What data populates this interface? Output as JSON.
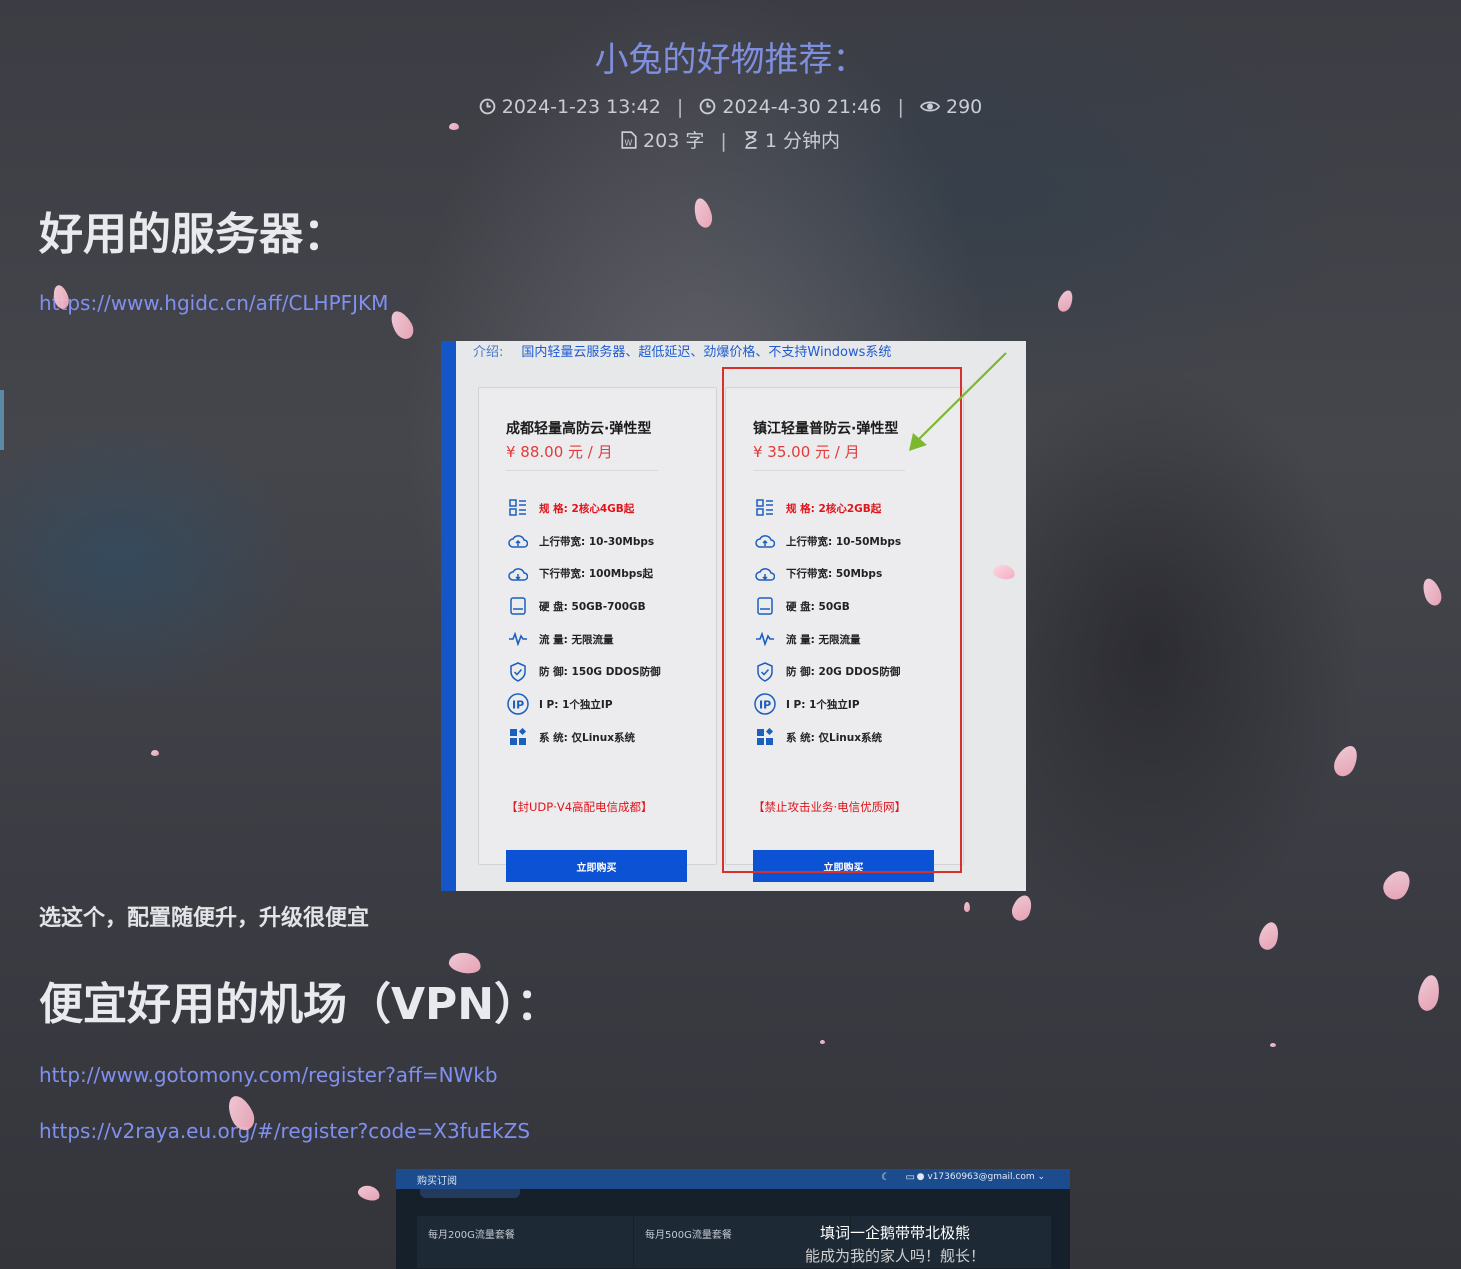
{
  "post": {
    "title": "小兔的好物推荐：",
    "created": "2024-1-23 13:42",
    "updated": "2024-4-30 21:46",
    "views": "290",
    "word_count": "203 字",
    "read_time": "1 分钟内"
  },
  "section1": {
    "heading": "好用的服务器：",
    "link": "https://www.hgidc.cn/aff/CLHPFJKM"
  },
  "server_shot": {
    "intro_key": "介绍:",
    "intro_value": "国内轻量云服务器、超低延迟、劲爆价格、不支持Windows系统",
    "cards": [
      {
        "name": "成都轻量高防云·弹性型",
        "price": "¥ 88.00 元 / 月",
        "specs": [
          {
            "icon": "spec-grid-icon",
            "text": "规 格: 2核心4GB起",
            "red": true
          },
          {
            "icon": "cloud-upload-icon",
            "text": "上行带宽: 10-30Mbps"
          },
          {
            "icon": "cloud-download-icon",
            "text": "下行带宽: 100Mbps起"
          },
          {
            "icon": "disk-icon",
            "text": "硬 盘: 50GB-700GB"
          },
          {
            "icon": "pulse-icon",
            "text": "流 量: 无限流量"
          },
          {
            "icon": "shield-icon",
            "text": "防 御: 150G DDOS防御"
          },
          {
            "icon": "ip-icon",
            "text": "I P: 1个独立IP"
          },
          {
            "icon": "apps-icon",
            "text": "系 统: 仅Linux系统"
          }
        ],
        "note": "【封UDP·V4高配电信成都】",
        "button": "立即购买"
      },
      {
        "name": "镇江轻量普防云·弹性型",
        "price": "¥ 35.00 元 / 月",
        "specs": [
          {
            "icon": "spec-grid-icon",
            "text": "规 格: 2核心2GB起",
            "red": true
          },
          {
            "icon": "cloud-upload-icon",
            "text": "上行带宽: 10-50Mbps"
          },
          {
            "icon": "cloud-download-icon",
            "text": "下行带宽: 50Mbps"
          },
          {
            "icon": "disk-icon",
            "text": "硬 盘: 50GB"
          },
          {
            "icon": "pulse-icon",
            "text": "流 量: 无限流量"
          },
          {
            "icon": "shield-icon",
            "text": "防 御: 20G DDOS防御"
          },
          {
            "icon": "ip-icon",
            "text": "I P: 1个独立IP"
          },
          {
            "icon": "apps-icon",
            "text": "系 统: 仅Linux系统"
          }
        ],
        "note": "【禁止攻击业务·电信优质网】",
        "button": "立即购买"
      }
    ],
    "colors": {
      "accent": "#0c52d4",
      "highlight": "#d9302b",
      "arrow": "#7cb82f"
    }
  },
  "section1_note": "选这个，配置随便升，升级很便宜",
  "section2": {
    "heading": "便宜好用的机场（VPN）：",
    "links": [
      "http://www.gotomony.com/register?aff=NWkb",
      "https://v2raya.eu.org/#/register?code=X3fuEkZS"
    ]
  },
  "vpn_shot": {
    "title": "购买订阅",
    "email": "v17360963@gmail.com",
    "plans": [
      "每月200G流量套餐",
      "每月500G流量套餐"
    ]
  },
  "chat": {
    "line1": "填词一企鹅带带北极熊",
    "line2": "能成为我的家人吗！舰长！"
  },
  "colors": {
    "title": "#7f8fe0",
    "link": "#8090ee",
    "heading": "#e9eaee"
  }
}
